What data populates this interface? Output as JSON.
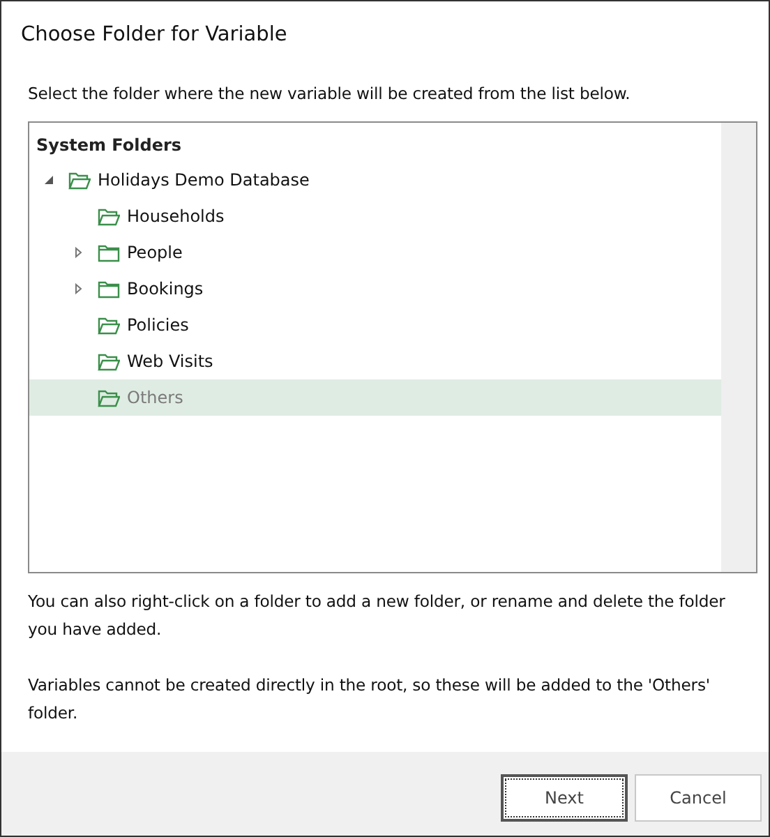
{
  "window": {
    "title": "Choose Folder for Variable"
  },
  "instruction": "Select the folder where the new variable will be created from the list below.",
  "tree": {
    "header": "System Folders",
    "items": [
      {
        "label": "Holidays Demo Database",
        "expanded": true,
        "selected": false,
        "children": [
          {
            "label": "Households",
            "selected": false
          },
          {
            "label": "People",
            "expanded": false,
            "selected": false
          },
          {
            "label": "Bookings",
            "expanded": false,
            "selected": false
          },
          {
            "label": "Policies",
            "selected": false
          },
          {
            "label": "Web Visits",
            "selected": false
          },
          {
            "label": "Others",
            "selected": true
          }
        ]
      }
    ]
  },
  "notes": [
    "You can also right-click on a folder to add a new folder, or rename and delete the folder you have added.",
    "Variables cannot be created directly in the root, so these will be added to the 'Others' folder."
  ],
  "buttons": [
    {
      "label": "Next",
      "default": true
    },
    {
      "label": "Cancel",
      "default": false
    }
  ]
}
